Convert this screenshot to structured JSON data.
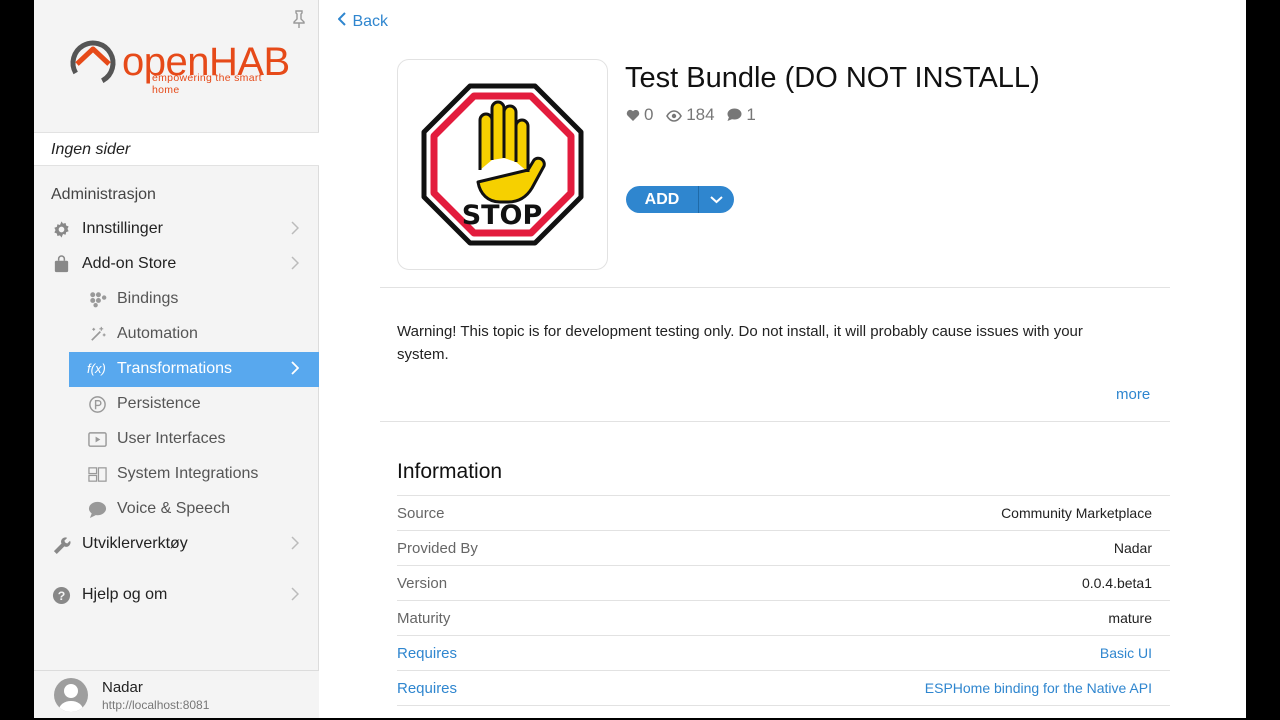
{
  "sidebar": {
    "logo": {
      "brand": "openHAB",
      "tagline": "empowering the smart home"
    },
    "pages_label": "Ingen sider",
    "section_title": "Administrasjon",
    "items": [
      {
        "label": "Innstillinger",
        "icon": "gear-icon"
      },
      {
        "label": "Add-on Store",
        "icon": "shopping-bag-icon"
      },
      {
        "label": "Bindings",
        "icon": "bindings-icon"
      },
      {
        "label": "Automation",
        "icon": "sparkle-icon"
      },
      {
        "label": "Transformations",
        "icon": "function-icon",
        "icon_text": "f(x)"
      },
      {
        "label": "Persistence",
        "icon": "persistence-icon"
      },
      {
        "label": "User Interfaces",
        "icon": "play-icon"
      },
      {
        "label": "System Integrations",
        "icon": "integrations-icon"
      },
      {
        "label": "Voice & Speech",
        "icon": "chat-bubble-icon"
      },
      {
        "label": "Utviklerverktøy",
        "icon": "wrench-icon"
      },
      {
        "label": "Hjelp og om",
        "icon": "help-icon",
        "icon_text": "?"
      }
    ],
    "user": {
      "name": "Nadar",
      "url": "http://localhost:8081"
    }
  },
  "main": {
    "back_label": "Back",
    "title": "Test Bundle (DO NOT INSTALL)",
    "stats": {
      "likes": "0",
      "views": "184",
      "comments": "1"
    },
    "logo_text": "STOP",
    "add_label": "ADD",
    "warning": "Warning! This topic is for development testing only. Do not install, it will probably cause issues with your system.",
    "more_label": "more",
    "info_title": "Information",
    "info_rows": [
      {
        "key": "Source",
        "value": "Community Marketplace"
      },
      {
        "key": "Provided By",
        "value": "Nadar"
      },
      {
        "key": "Version",
        "value": "0.0.4.beta1"
      },
      {
        "key": "Maturity",
        "value": "mature"
      },
      {
        "key": "Requires",
        "value": "Basic UI"
      },
      {
        "key": "Requires",
        "value": "ESPHome binding for the Native API"
      }
    ]
  },
  "colors": {
    "accent": "#2f86cf",
    "active_nav": "#58a8ee",
    "brand": "#e64a19"
  }
}
